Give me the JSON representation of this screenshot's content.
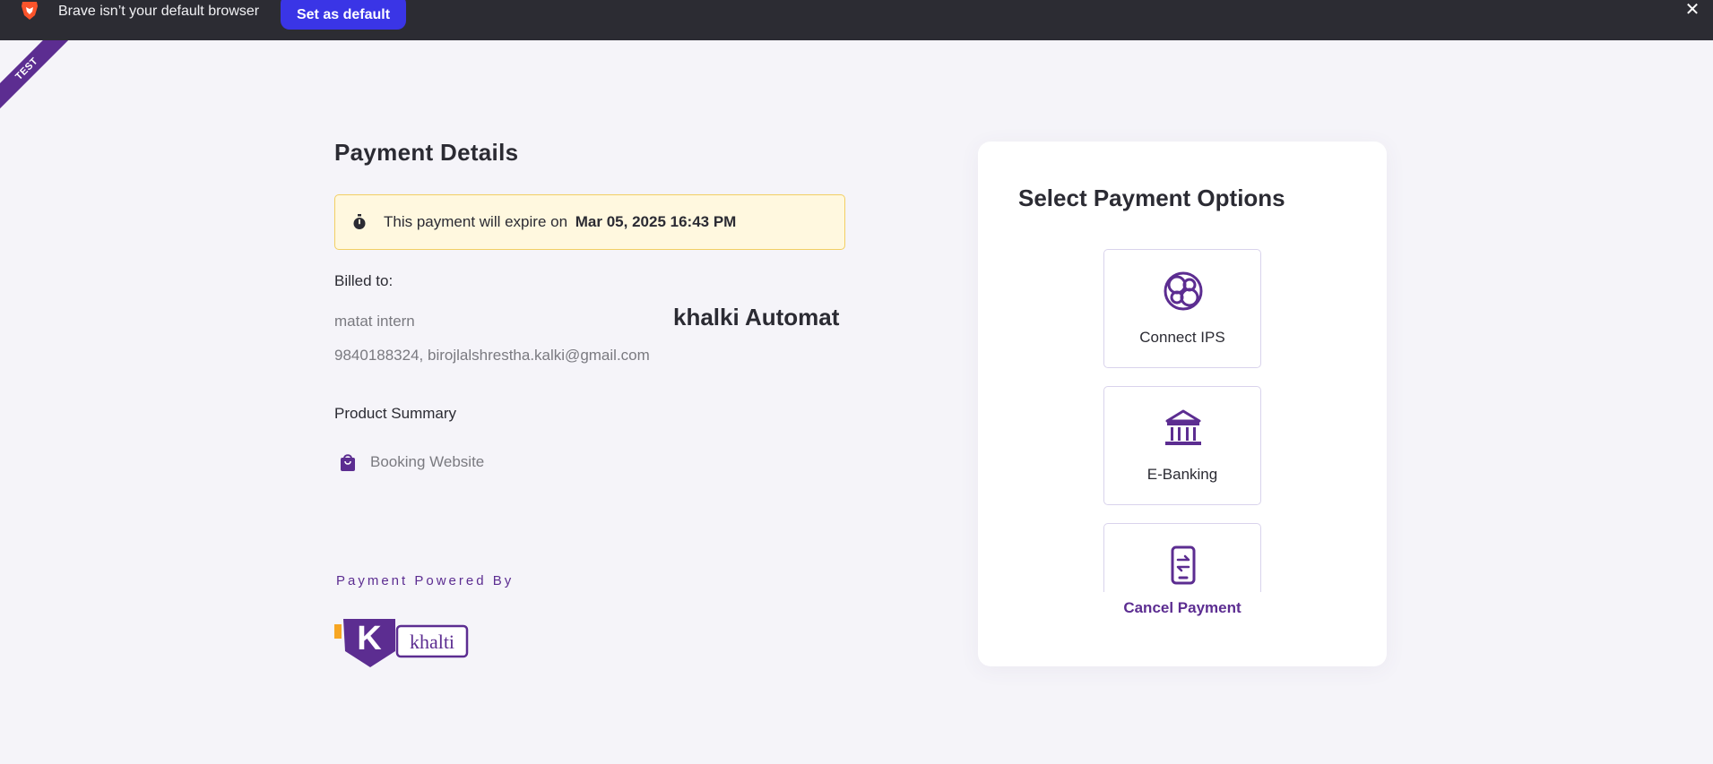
{
  "browser_bar": {
    "message": "Brave isn’t your default browser",
    "set_default_label": "Set as default",
    "close_label": "✕"
  },
  "ribbon": {
    "label": "TEST"
  },
  "payment": {
    "title": "Payment Details",
    "expiry_prefix": "This payment will expire on",
    "expiry_date": "Mar 05, 2025 16:43 PM",
    "billed_label": "Billed to:",
    "customer_name": "matat intern",
    "merchant_name": "khalki Automat",
    "customer_contact": "9840188324, birojlalshrestha.kalki@gmail.com",
    "product_summary_label": "Product Summary",
    "product_name": "Booking Website",
    "powered_by": "Payment Powered By",
    "brand_logo_text": "khalti"
  },
  "options_card": {
    "title": "Select Payment Options",
    "options": [
      {
        "label": "Connect IPS",
        "icon": "connect-ips-icon"
      },
      {
        "label": "E-Banking",
        "icon": "bank-icon"
      },
      {
        "label": "",
        "icon": "mobile-transfer-icon"
      }
    ],
    "cancel_label": "Cancel Payment"
  },
  "colors": {
    "brand_purple": "#5c2d91",
    "infobar_bg": "#2c2c33",
    "set_default_bg": "#3a35e6",
    "warning_bg": "#fff8df",
    "warning_border": "#f2cf63",
    "page_bg": "#f5f4f9"
  }
}
